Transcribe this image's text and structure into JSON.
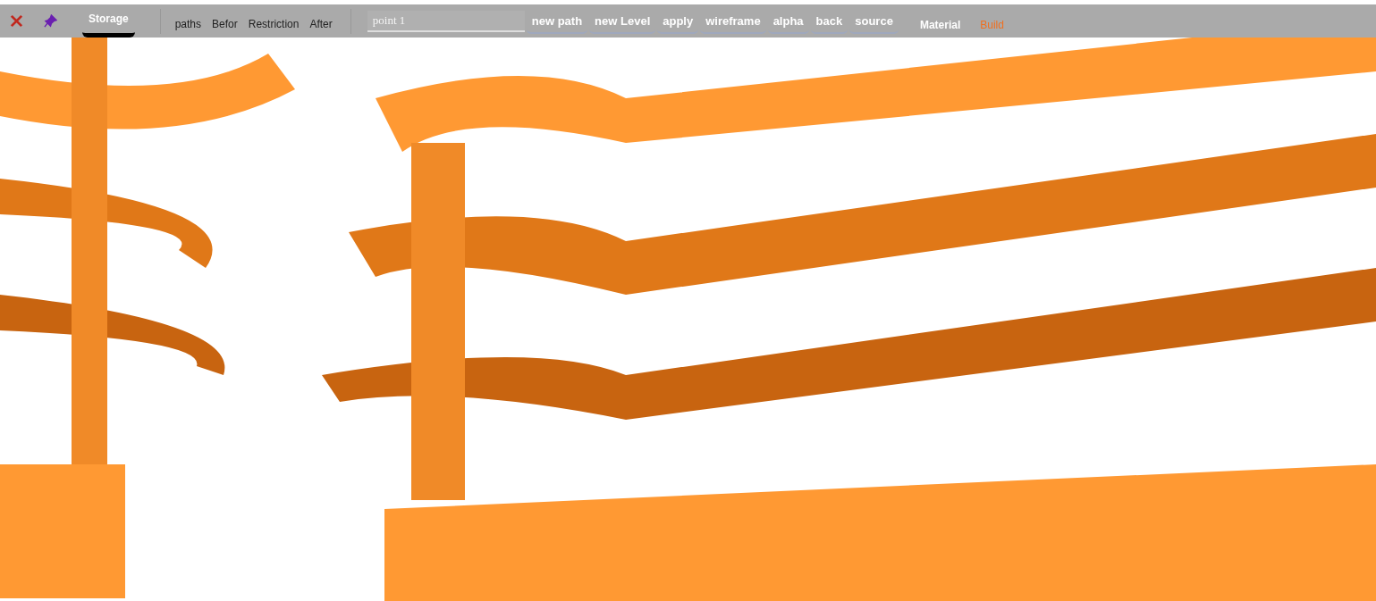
{
  "toolbar": {
    "icons": [
      {
        "kind": "close"
      },
      {
        "kind": "pin"
      }
    ],
    "tabs": [
      {
        "label": "Storage",
        "selected": true
      },
      {
        "label": "paths",
        "selected": false
      },
      {
        "label": "Befor",
        "selected": false
      },
      {
        "label": "Restriction",
        "selected": false
      },
      {
        "label": "After",
        "selected": false
      }
    ],
    "search": {
      "placeholder": "point 1"
    },
    "buttons": [
      "new path",
      "new Level",
      "apply",
      "wireframe",
      "alpha",
      "back",
      "source"
    ],
    "modes": [
      {
        "label": "Material",
        "selected": false
      },
      {
        "label": "Build",
        "selected": true
      }
    ]
  }
}
